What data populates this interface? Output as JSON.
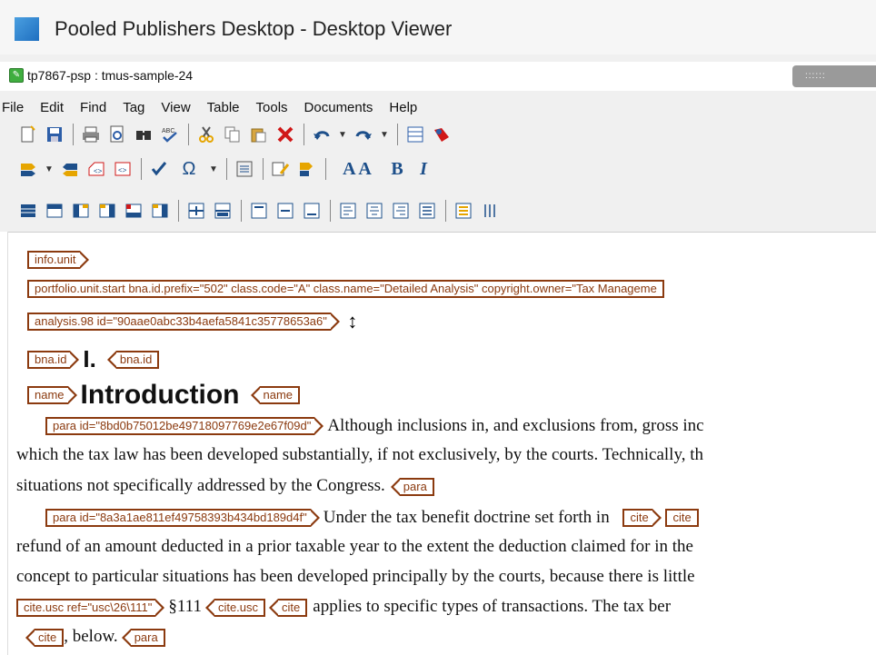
{
  "window": {
    "title": "Pooled Publishers Desktop - Desktop Viewer"
  },
  "document": {
    "tab_title": "tp7867-psp : tmus-sample-24",
    "grip": "::::::"
  },
  "menu": [
    "File",
    "Edit",
    "Find",
    "Tag",
    "View",
    "Table",
    "Tools",
    "Documents",
    "Help"
  ],
  "toolbar": {
    "row1": [
      "new-doc-icon",
      "save-icon",
      "print-icon",
      "print-preview-icon",
      "find-icon",
      "spellcheck-icon",
      "cut-icon",
      "copy-icon",
      "paste-icon",
      "delete-icon",
      "undo-icon",
      "redo-icon",
      "table-icon",
      "tag-color-icon"
    ],
    "row2": [
      "insert-element-icon",
      "insert-after-icon",
      "insert-image-icon",
      "insert-link-icon",
      "check-icon",
      "special-char-icon",
      "format-icon",
      "edit-attr-icon",
      "bold-tag-icon",
      "font-size-icon",
      "bold-icon",
      "italic-icon"
    ],
    "row3": [
      "table-insert-icon",
      "table-row-icon",
      "table-col-icon",
      "table-col2-icon",
      "table-row2-icon",
      "table-merge-icon",
      "split-icon",
      "merge-icon",
      "align-top-icon",
      "align-middle-icon",
      "align-bottom-icon",
      "align-left-icon",
      "align-center-icon",
      "align-right-icon",
      "justify-icon",
      "list-icon",
      "columns-icon"
    ],
    "glyphs": {
      "bold": "B",
      "italic": "I",
      "font_size": "A A",
      "omega": "Ω",
      "spell": "ABC"
    }
  },
  "editor": {
    "tags": {
      "info_unit": "info.unit",
      "portfolio": "portfolio.unit.start bna.id.prefix=\"502\" class.code=\"A\" class.name=\"Detailed Analysis\" copyright.owner=\"Tax Manageme",
      "analysis": "analysis.98 id=\"90aae0abc33b4aefa5841c35778653a6\"",
      "bna_id": "bna.id",
      "name": "name",
      "para1": "para id=\"8bd0b75012be49718097769e2e67f09d\"",
      "para": "para",
      "para2": "para id=\"8a3a1ae811ef49758393b434bd189d4f\"",
      "cite": "cite",
      "cite_usc": "cite.usc ref=\"usc\\26\\111\"",
      "cite_usc_close": "cite.usc"
    },
    "numeral": "I.",
    "heading": "Introduction",
    "para1": {
      "start": "Although inclusions in, and exclusions from, gross inc",
      "line2": "which the tax law has been developed substantially, if not exclusively, by the courts. Technically, th",
      "line3": "situations not specifically addressed by the Congress."
    },
    "para2": {
      "start": "Under the tax benefit doctrine set forth in",
      "line2": "refund of an amount deducted in a prior taxable year to the extent the deduction claimed for in the",
      "line3": "concept to particular situations has been developed principally by the courts, because there is little",
      "section": "§111",
      "line4_tail": "applies to specific types of transactions. The tax ber",
      "line5": ", below."
    }
  }
}
